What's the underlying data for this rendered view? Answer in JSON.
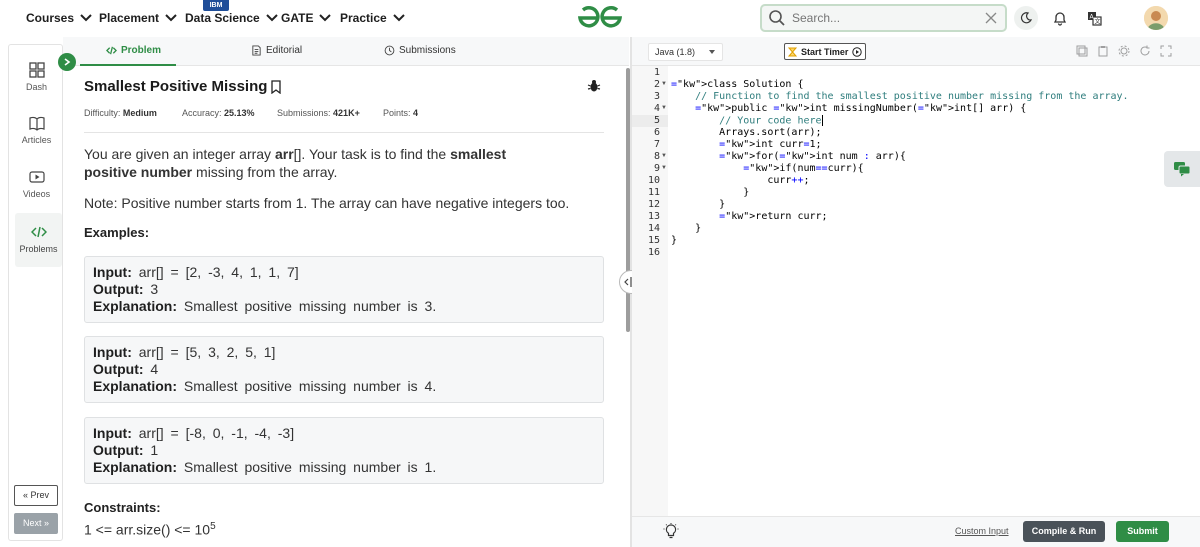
{
  "nav": {
    "items": [
      {
        "label": "Courses"
      },
      {
        "label": "Placement"
      },
      {
        "label": "Data Science"
      },
      {
        "label": "GATE"
      },
      {
        "label": "Practice"
      }
    ],
    "data_science_badge": "IBM",
    "search_placeholder": "Search...",
    "accent": "#2f8d46"
  },
  "sidebar": {
    "items": [
      {
        "label": "Dash",
        "icon": "dashboard-icon"
      },
      {
        "label": "Articles",
        "icon": "book-icon"
      },
      {
        "label": "Videos",
        "icon": "video-icon"
      },
      {
        "label": "Problems",
        "icon": "code-icon"
      }
    ],
    "prev_label": "Prev",
    "next_label": "Next"
  },
  "tabs": {
    "problem": "Problem",
    "editorial": "Editorial",
    "submissions": "Submissions"
  },
  "problem": {
    "title": "Smallest Positive Missing",
    "difficulty_label": "Difficulty:",
    "difficulty": "Medium",
    "accuracy_label": "Accuracy:",
    "accuracy": "25.13%",
    "submissions_label": "Submissions:",
    "submissions": "421K+",
    "points_label": "Points:",
    "points": "4",
    "desc_1a": "You are given an integer array ",
    "desc_1b": "arr",
    "desc_1c": "[]. Your task is to find the ",
    "desc_1d": "smallest positive number",
    "desc_1e": " missing from the array.",
    "note": "Note: Positive number starts from 1. The array can have negative integers too.",
    "examples_heading": "Examples:",
    "input_label": "Input:",
    "output_label": "Output:",
    "explanation_label": "Explanation:",
    "examples": [
      {
        "input": "arr[] = [2, -3, 4, 1, 1, 7]",
        "output": "3",
        "explanation": "Smallest positive missing number is 3."
      },
      {
        "input": "arr[] = [5, 3, 2, 5, 1]",
        "output": "4",
        "explanation": "Smallest positive missing number is 4."
      },
      {
        "input": "arr[] = [-8, 0, -1, -4, -3]",
        "output": "1",
        "explanation": "Smallest positive missing number is 1."
      }
    ],
    "constraints_heading": "Constraints:",
    "constraint_1": "1 <= arr.size() <= 10",
    "constraint_1_exp": "5"
  },
  "editor": {
    "language": "Java (1.8)",
    "timer_label": "Start Timer",
    "custom_input": "Custom Input",
    "compile_run": "Compile & Run",
    "submit": "Submit",
    "line_numbers": [
      "1",
      "2",
      "3",
      "4",
      "5",
      "6",
      "7",
      "8",
      "9",
      "10",
      "11",
      "12",
      "13",
      "14",
      "15",
      "16"
    ],
    "code_lines": [
      "",
      "class Solution {",
      "    // Function to find the smallest positive number missing from the array.",
      "    public int missingNumber(int[] arr) {",
      "        // Your code here",
      "        Arrays.sort(arr);",
      "        int curr=1;",
      "        for(int num : arr){",
      "            if(num==curr){",
      "                curr++;",
      "            }",
      "        }",
      "        return curr;",
      "    }",
      "}",
      ""
    ]
  }
}
